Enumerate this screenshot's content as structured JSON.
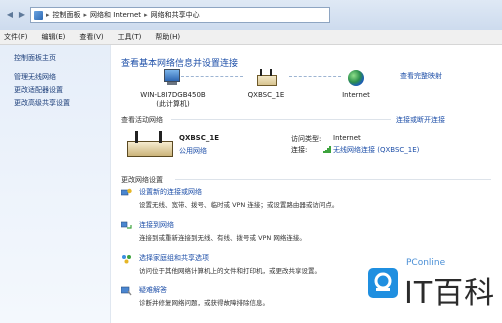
{
  "address_bar": {
    "crumbs": [
      "控制面板",
      "网络和 Internet",
      "网络和共享中心"
    ]
  },
  "menu": [
    "文件(F)",
    "编辑(E)",
    "查看(V)",
    "工具(T)",
    "帮助(H)"
  ],
  "sidebar": {
    "items": [
      {
        "label": "控制面板主页"
      },
      {
        "label": "管理无线网络"
      },
      {
        "label": "更改适配器设置"
      },
      {
        "label": "更改高级共享设置"
      }
    ]
  },
  "main": {
    "title": "查看基本网络信息并设置连接",
    "full_map": "查看完整映射",
    "map": {
      "computer_name": "WIN-L8I7DGB450B",
      "computer_sub": "(此计算机)",
      "router_name": "QXBSC_1E",
      "internet_name": "Internet"
    },
    "active": {
      "header": "查看活动网络",
      "connect_link": "连接或断开连接",
      "network_name": "QXBSC_1E",
      "network_type": "公用网络",
      "access_type_label": "访问类型:",
      "access_type_value": "Internet",
      "connection_label": "连接:",
      "connection_value": "无线网络连接 (QXBSC_1E)"
    },
    "change_header": "更改网络设置",
    "tasks": [
      {
        "title": "设置新的连接或网络",
        "desc": "设置无线、宽带、拨号、临时或 VPN 连接；或设置路由器或访问点。"
      },
      {
        "title": "连接到网络",
        "desc": "连接到或重新连接到无线、有线、拨号或 VPN 网络连接。"
      },
      {
        "title": "选择家庭组和共享选项",
        "desc": "访问位于其他网络计算机上的文件和打印机，或更改共享设置。"
      },
      {
        "title": "疑难解答",
        "desc": "诊断并修复网络问题，或获得故障排除信息。"
      }
    ]
  },
  "watermark": {
    "brand": "PConline",
    "text": "IT百科"
  }
}
